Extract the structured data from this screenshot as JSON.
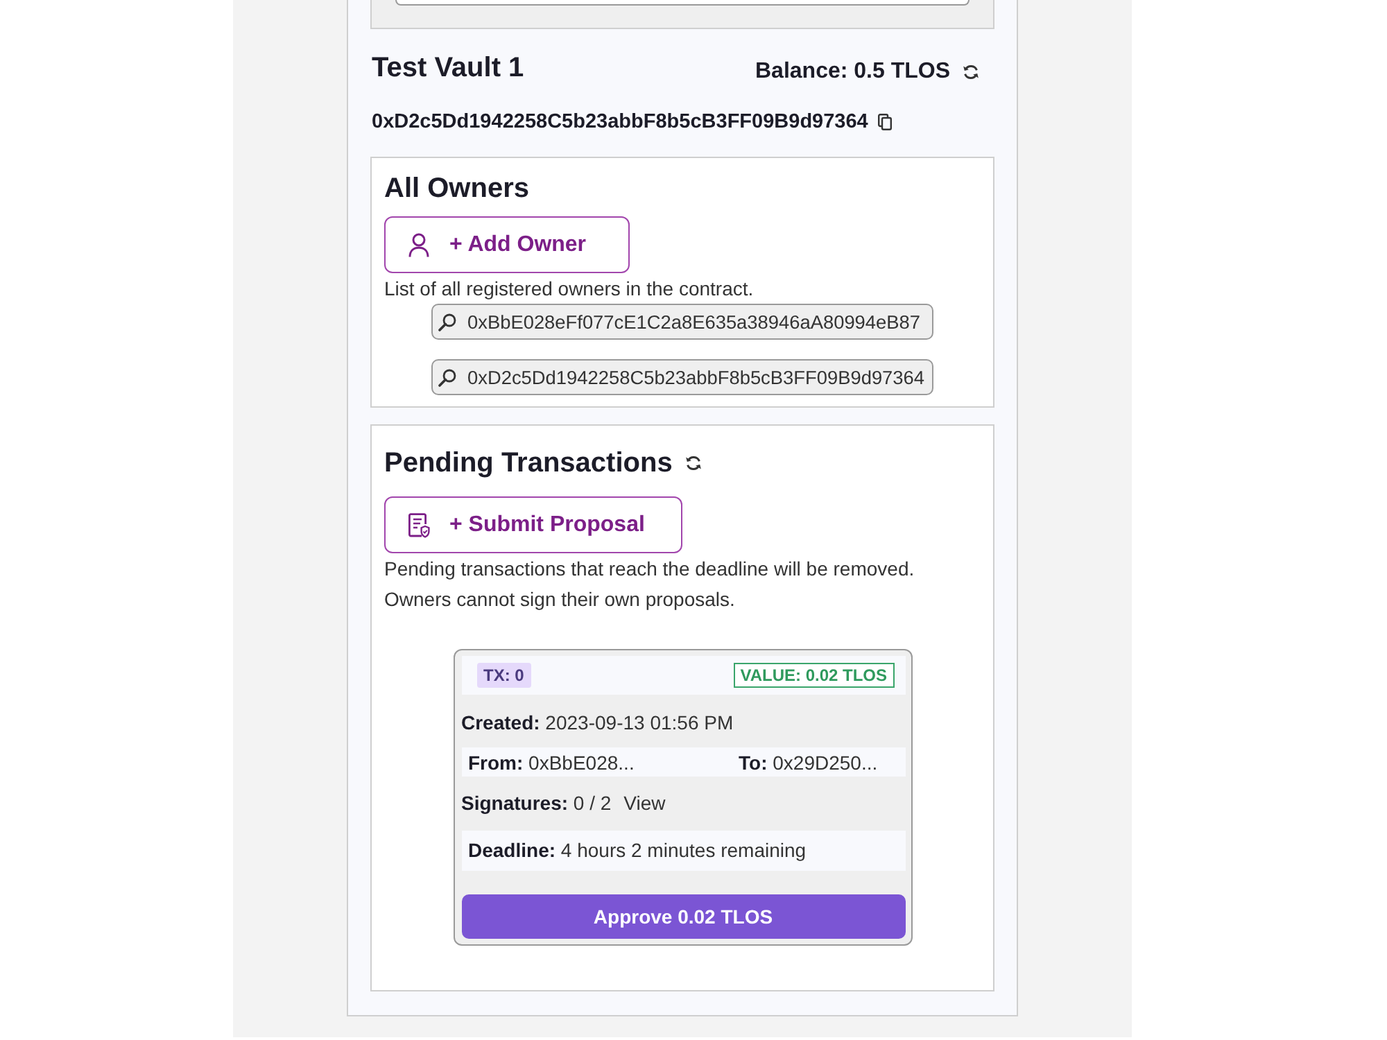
{
  "vault": {
    "title": "Test Vault 1",
    "balance": "Balance: 0.5 TLOS",
    "address": "0xD2c5Dd1942258C5b23abbF8b5cB3FF09B9d97364"
  },
  "owners_section": {
    "title": "All Owners",
    "add_button": "+ Add Owner",
    "description": "List of all registered owners in the contract.",
    "owners": [
      {
        "address": "0xBbE028eFf077cE1C2a8E635a38946aA80994eB87"
      },
      {
        "address": "0xD2c5Dd1942258C5b23abbF8b5cB3FF09B9d97364"
      }
    ]
  },
  "pending_section": {
    "title": "Pending Transactions",
    "submit_button": "+ Submit Proposal",
    "notes": [
      "Pending transactions that reach the deadline will be removed.",
      "Owners cannot sign their own proposals."
    ],
    "transactions": [
      {
        "tx": "TX: 0",
        "value": "VALUE: 0.02 TLOS",
        "created": "**Created:** 2023-09-13 01:56 PM",
        "from": "**From:** 0xBbE028...",
        "to": "**To:** 0x29D250...",
        "signatures": "**Signatures:** 0 / 2",
        "view_link": "View",
        "deadline": "**Deadline:** 4 hours 2 minutes remaining",
        "approve_button": "Approve 0.02 TLOS"
      }
    ]
  }
}
